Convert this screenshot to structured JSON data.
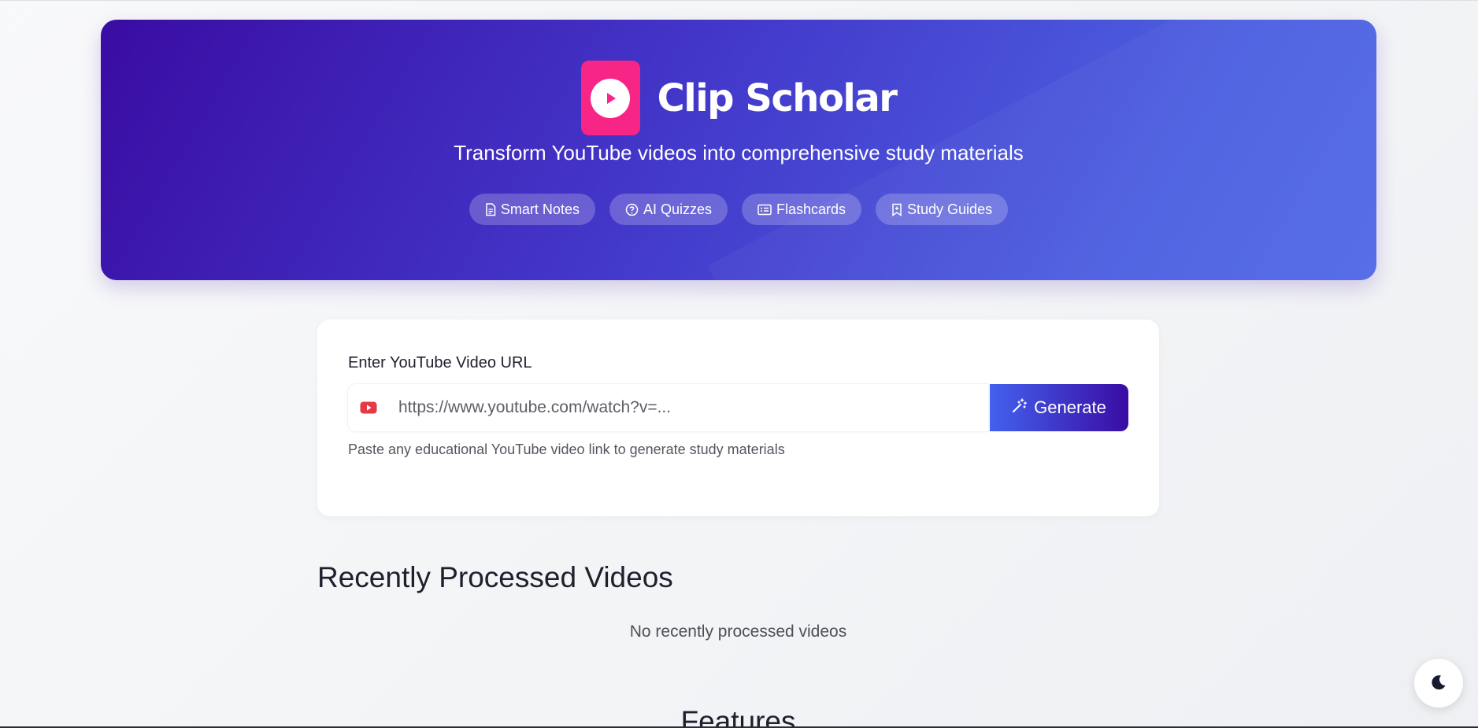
{
  "app": {
    "title": "Clip Scholar",
    "subtitle": "Transform YouTube videos into comprehensive study materials",
    "logo_icon": "play-icon",
    "brand_color": "#f72585",
    "accent_gradient": [
      "#4361ee",
      "#3a0ca3"
    ]
  },
  "features": [
    {
      "label": "Smart Notes",
      "icon": "document-icon"
    },
    {
      "label": "AI Quizzes",
      "icon": "question-circle-icon"
    },
    {
      "label": "Flashcards",
      "icon": "card-list-icon"
    },
    {
      "label": "Study Guides",
      "icon": "bookmark-icon"
    }
  ],
  "url_form": {
    "label": "Enter YouTube Video URL",
    "placeholder": "https://www.youtube.com/watch?v=...",
    "value": "",
    "button_label": "Generate",
    "button_icon": "magic-wand-icon",
    "input_icon": "youtube-icon",
    "help_text": "Paste any educational YouTube video link to generate study materials"
  },
  "recent": {
    "title": "Recently Processed Videos",
    "empty_message": "No recently processed videos"
  },
  "features_section": {
    "title": "Features"
  },
  "theme_toggle": {
    "icon": "moon-icon"
  }
}
